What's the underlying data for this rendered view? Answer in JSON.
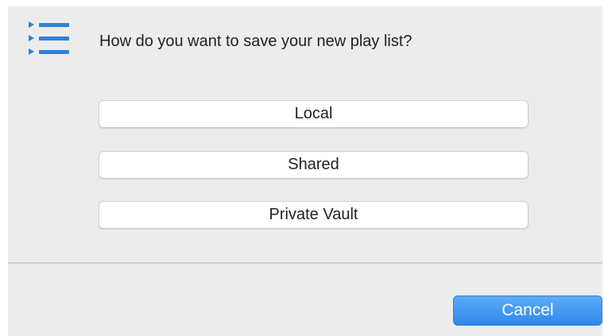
{
  "dialog": {
    "icon": "playlist-icon",
    "prompt": "How do you want to save your new play list?",
    "options": [
      {
        "label": "Local"
      },
      {
        "label": "Shared"
      },
      {
        "label": "Private Vault"
      }
    ],
    "cancel_label": "Cancel"
  },
  "colors": {
    "background": "#ececec",
    "icon": "#2f7fdc",
    "primary_button": "#3d93ee"
  }
}
